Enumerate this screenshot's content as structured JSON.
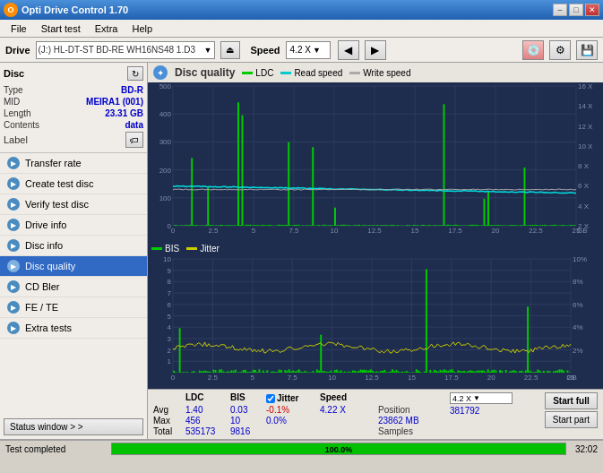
{
  "titleBar": {
    "title": "Opti Drive Control 1.70",
    "minimizeLabel": "–",
    "maximizeLabel": "□",
    "closeLabel": "✕"
  },
  "menuBar": {
    "items": [
      "File",
      "Start test",
      "Extra",
      "Help"
    ]
  },
  "driveBar": {
    "driveLabel": "Drive",
    "driveValue": "(J:)  HL-DT-ST BD-RE  WH16NS48 1.D3",
    "speedLabel": "Speed",
    "speedValue": "4.2 X"
  },
  "sidebar": {
    "discTitle": "Disc",
    "rows": [
      {
        "label": "Type",
        "value": "BD-R"
      },
      {
        "label": "MID",
        "value": "MEIRA1 (001)"
      },
      {
        "label": "Length",
        "value": "23.31 GB"
      },
      {
        "label": "Contents",
        "value": "data"
      },
      {
        "label": "Label",
        "value": ""
      }
    ],
    "navItems": [
      {
        "label": "Transfer rate",
        "color": "#4a90d9"
      },
      {
        "label": "Create test disc",
        "color": "#4a90d9"
      },
      {
        "label": "Verify test disc",
        "color": "#4a90d9"
      },
      {
        "label": "Drive info",
        "color": "#4a90d9"
      },
      {
        "label": "Disc info",
        "color": "#4a90d9"
      },
      {
        "label": "Disc quality",
        "color": "#4a90d9",
        "active": true
      },
      {
        "label": "CD Bler",
        "color": "#4a90d9"
      },
      {
        "label": "FE / TE",
        "color": "#4a90d9"
      },
      {
        "label": "Extra tests",
        "color": "#4a90d9"
      }
    ],
    "statusWindowLabel": "Status window > >"
  },
  "chartArea": {
    "title": "Disc quality",
    "legends": [
      {
        "label": "LDC",
        "color": "#00cc00"
      },
      {
        "label": "Read speed",
        "color": "#00cccc"
      },
      {
        "label": "Write speed",
        "color": "#ffffff"
      }
    ],
    "chart2Legends": [
      {
        "label": "BIS",
        "color": "#00cc00"
      },
      {
        "label": "Jitter",
        "color": "#cccc00"
      }
    ]
  },
  "statsBar": {
    "columns": [
      {
        "header": "",
        "avg": "Avg",
        "max": "Max",
        "total": "Total"
      },
      {
        "header": "LDC",
        "avg": "1.40",
        "max": "456",
        "total": "535173"
      },
      {
        "header": "BIS",
        "avg": "0.03",
        "max": "10",
        "total": "9816"
      },
      {
        "header": "Jitter",
        "avg": "-0.1%",
        "max": "0.0%",
        "total": "",
        "checked": true
      },
      {
        "header": "Speed",
        "avg": "4.22 X",
        "max": "",
        "total": ""
      },
      {
        "header": "Position",
        "avg": "",
        "max": "23862 MB",
        "total": "381792"
      }
    ],
    "speedSelect": "4.2 X",
    "startFullLabel": "Start full",
    "startPartLabel": "Start part",
    "samplesLabel": "Samples",
    "samplesValue": "381792"
  },
  "statusBar": {
    "statusWindowText": "Status window > >",
    "testCompletedText": "Test completed",
    "progressPercent": "100.0%",
    "progressValue": 100,
    "timeText": "32:02"
  }
}
